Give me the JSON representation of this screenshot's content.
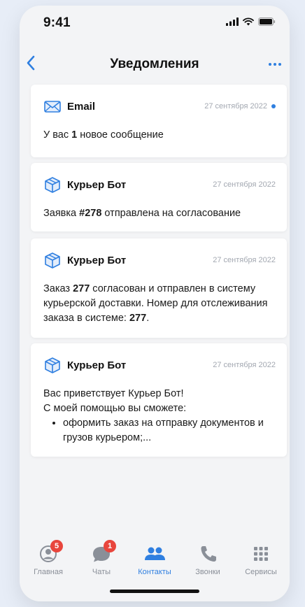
{
  "status_bar": {
    "time": "9:41"
  },
  "nav": {
    "title": "Уведомления"
  },
  "notifications": [
    {
      "sender": "Email",
      "icon": "envelope-icon",
      "date": "27 сентября 2022",
      "unread": true,
      "body": [
        [
          "У вас ",
          false
        ],
        [
          "1",
          true
        ],
        [
          " новое сообщение",
          false
        ]
      ]
    },
    {
      "sender": "Курьер Бот",
      "icon": "box-icon",
      "date": "27 сентября 2022",
      "unread": false,
      "body": [
        [
          "Заявка ",
          false
        ],
        [
          "#278",
          true
        ],
        [
          " отправлена на согласование",
          false
        ]
      ]
    },
    {
      "sender": "Курьер Бот",
      "icon": "box-icon",
      "date": "27 сентября 2022",
      "unread": false,
      "body": [
        [
          "Заказ ",
          false
        ],
        [
          "277",
          true
        ],
        [
          " согласован и отправлен в систему курьерской доставки. Номер для отслеживания заказа в системе: ",
          false
        ],
        [
          "277",
          true
        ],
        [
          ".",
          false
        ]
      ]
    },
    {
      "sender": "Курьер Бот",
      "icon": "box-icon",
      "date": "27 сентября 2022",
      "unread": false,
      "lines": [
        "Вас приветствует Курьер Бот!",
        "С моей помощью вы сможете:"
      ],
      "bullets": [
        "оформить заказ на отправку документов и грузов курьером;..."
      ]
    }
  ],
  "tabs": [
    {
      "label": "Главная",
      "icon": "profile-icon",
      "badge": "5",
      "active": false
    },
    {
      "label": "Чаты",
      "icon": "chat-bubble-icon",
      "badge": "1",
      "active": false
    },
    {
      "label": "Контакты",
      "icon": "contacts-icon",
      "badge": null,
      "active": true
    },
    {
      "label": "Звонки",
      "icon": "phone-icon",
      "badge": null,
      "active": false
    },
    {
      "label": "Сервисы",
      "icon": "grid-icon",
      "badge": null,
      "active": false
    }
  ],
  "colors": {
    "accent": "#2f7fe0",
    "badge": "#e8453c",
    "background": "#e7edf7",
    "card": "#ffffff",
    "muted": "#a3a8b1"
  }
}
